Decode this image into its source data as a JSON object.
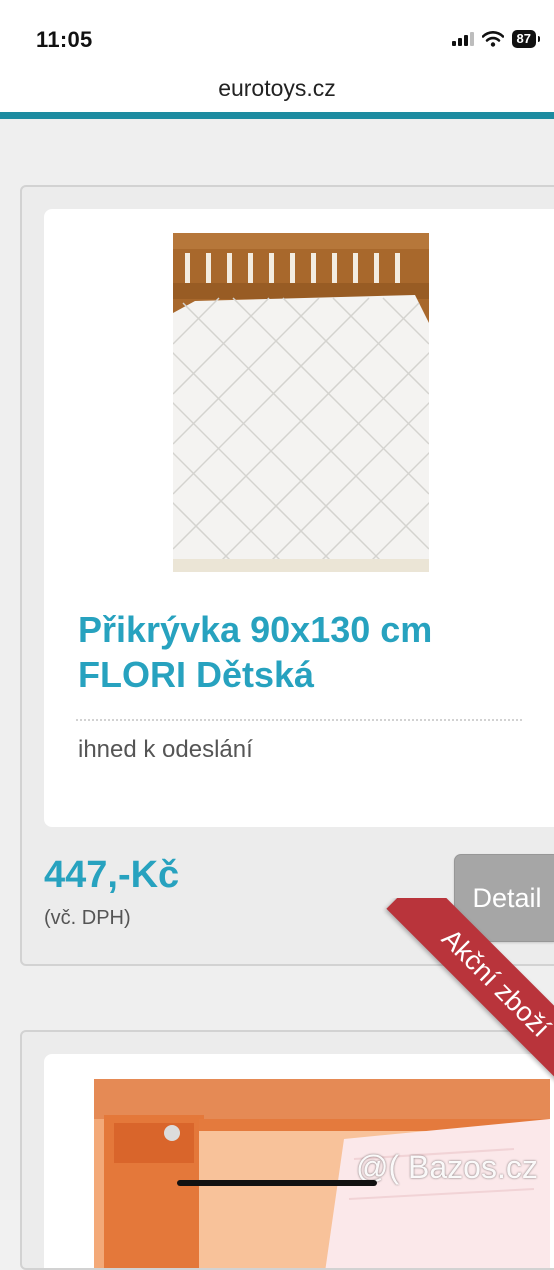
{
  "status_bar": {
    "time": "11:05",
    "battery": "87"
  },
  "browser": {
    "url": "eurotoys.cz"
  },
  "product": {
    "title": "Přikrývka 90x130 cm FLORI Dětská",
    "availability": "ihned k odeslání",
    "price": "447,-Kč",
    "vat_note": "(vč. DPH)",
    "detail_label": "Detail"
  },
  "next_product": {
    "ribbon": "Akční zboží"
  },
  "watermark": "@( Bazos.cz",
  "colors": {
    "accent": "#1d8ba0",
    "title": "#27a2bf",
    "ribbon": "#b9343b",
    "button": "#a6a6a6"
  }
}
